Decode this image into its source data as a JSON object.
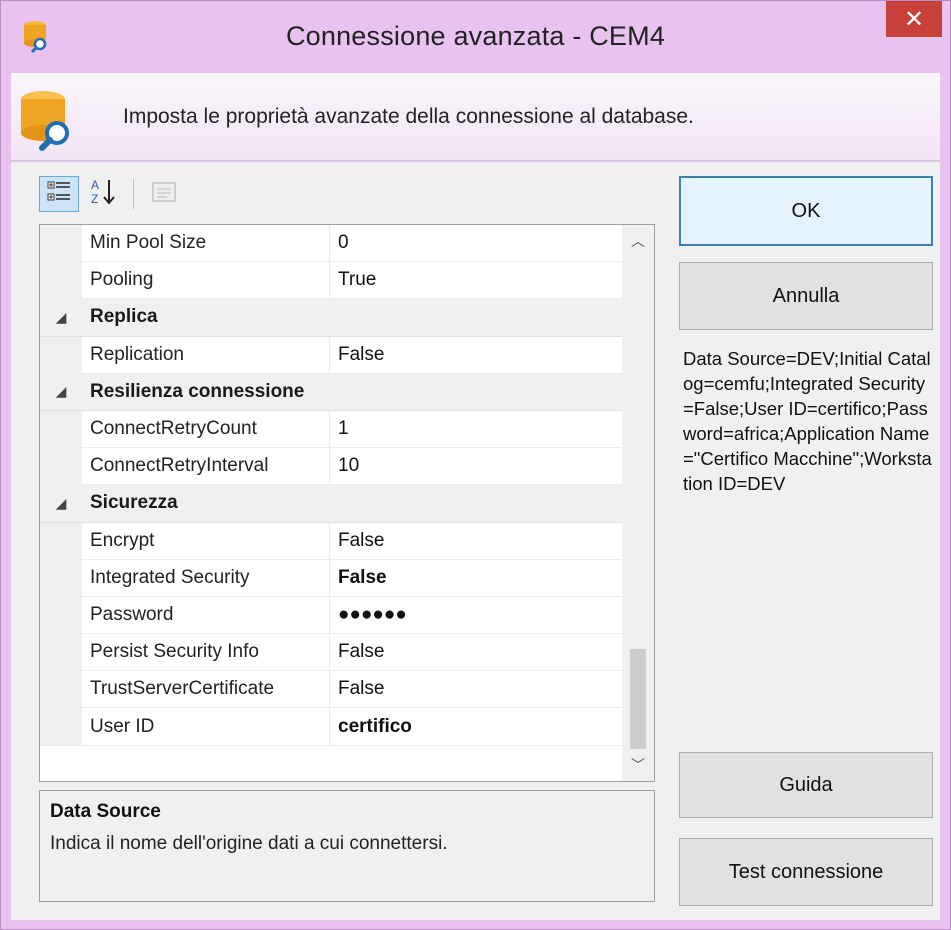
{
  "window": {
    "title": "Connessione avanzata - CEM4",
    "close_label": "✕"
  },
  "banner": {
    "text": "Imposta le proprietà avanzate della connessione al database."
  },
  "toolbar": {
    "categorized_icon": "categorized-view-icon",
    "alphabetical_icon": "sort-alphabetical-icon",
    "property_pages_icon": "property-pages-icon"
  },
  "grid": {
    "rows": [
      {
        "type": "prop",
        "name": "Min Pool Size",
        "value": "0",
        "bold": false
      },
      {
        "type": "prop",
        "name": "Pooling",
        "value": "True",
        "bold": false
      },
      {
        "type": "category",
        "name": "Replica"
      },
      {
        "type": "prop",
        "name": "Replication",
        "value": "False",
        "bold": false
      },
      {
        "type": "category",
        "name": "Resilienza connessione"
      },
      {
        "type": "prop",
        "name": "ConnectRetryCount",
        "value": "1",
        "bold": false
      },
      {
        "type": "prop",
        "name": "ConnectRetryInterval",
        "value": "10",
        "bold": false
      },
      {
        "type": "category",
        "name": "Sicurezza"
      },
      {
        "type": "prop",
        "name": "Encrypt",
        "value": "False",
        "bold": false
      },
      {
        "type": "prop",
        "name": "Integrated Security",
        "value": "False",
        "bold": true
      },
      {
        "type": "prop",
        "name": "Password",
        "value": "●●●●●●",
        "bold": true
      },
      {
        "type": "prop",
        "name": "Persist Security Info",
        "value": "False",
        "bold": false
      },
      {
        "type": "prop",
        "name": "TrustServerCertificate",
        "value": "False",
        "bold": false
      },
      {
        "type": "prop",
        "name": "User ID",
        "value": "certifico",
        "bold": true
      }
    ]
  },
  "description": {
    "title": "Data Source",
    "text": "Indica il nome dell'origine dati a cui connettersi."
  },
  "buttons": {
    "ok": "OK",
    "cancel": "Annulla",
    "help": "Guida",
    "test": "Test connessione"
  },
  "connection_string": "Data Source=DEV;Initial Catalog=cemfu;Integrated Security=False;User ID=certifico;Password=africa;Application Name=\"Certifico Macchine\";Workstation ID=DEV",
  "colors": {
    "chrome": "#e9c3f0",
    "close": "#c7403a",
    "accent": "#3c7fb1"
  }
}
